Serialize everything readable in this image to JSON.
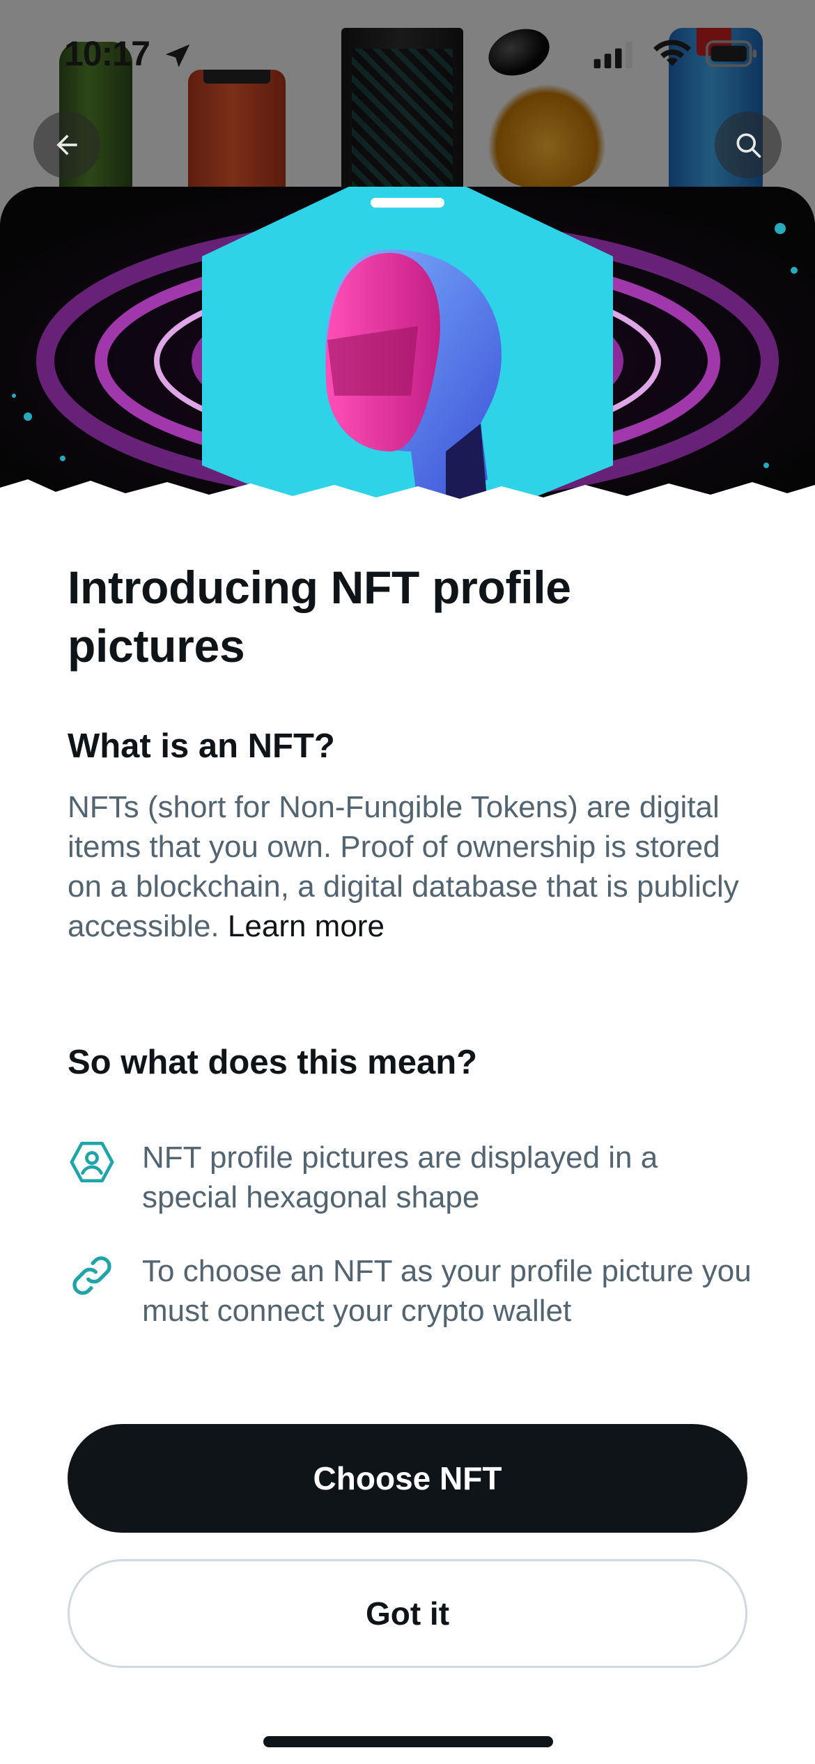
{
  "status_bar": {
    "time": "10:17",
    "icons": [
      "location-arrow-icon",
      "cellular-signal-icon",
      "wifi-icon",
      "battery-icon"
    ]
  },
  "background": {
    "nav": {
      "back_icon": "arrow-left-icon",
      "search_icon": "search-icon"
    }
  },
  "sheet": {
    "title": "Introducing NFT profile pictures",
    "section_what": {
      "heading": "What is an NFT?",
      "body": "NFTs (short for Non-Fungible Tokens) are digital items that you own. Proof of ownership is stored on a blockchain, a digital database that is publicly accessible.",
      "link": "Learn more"
    },
    "section_meaning": {
      "heading": "So what does this mean?",
      "items": [
        {
          "icon": "hexagon-profile-icon",
          "text": "NFT profile pictures are displayed in a special hexagonal shape"
        },
        {
          "icon": "link-icon",
          "text": "To choose an NFT as your profile picture you must connect your crypto wallet"
        }
      ]
    },
    "buttons": {
      "primary": "Choose NFT",
      "secondary": "Got it"
    }
  },
  "colors": {
    "text_primary": "#0f1419",
    "text_secondary": "#536471",
    "accent_teal": "#1fa4a9",
    "button_dark": "#0f1419",
    "button_border": "#cfd9de",
    "hero_cyan": "#2fd3e8",
    "hero_magenta": "#e53cc6"
  }
}
